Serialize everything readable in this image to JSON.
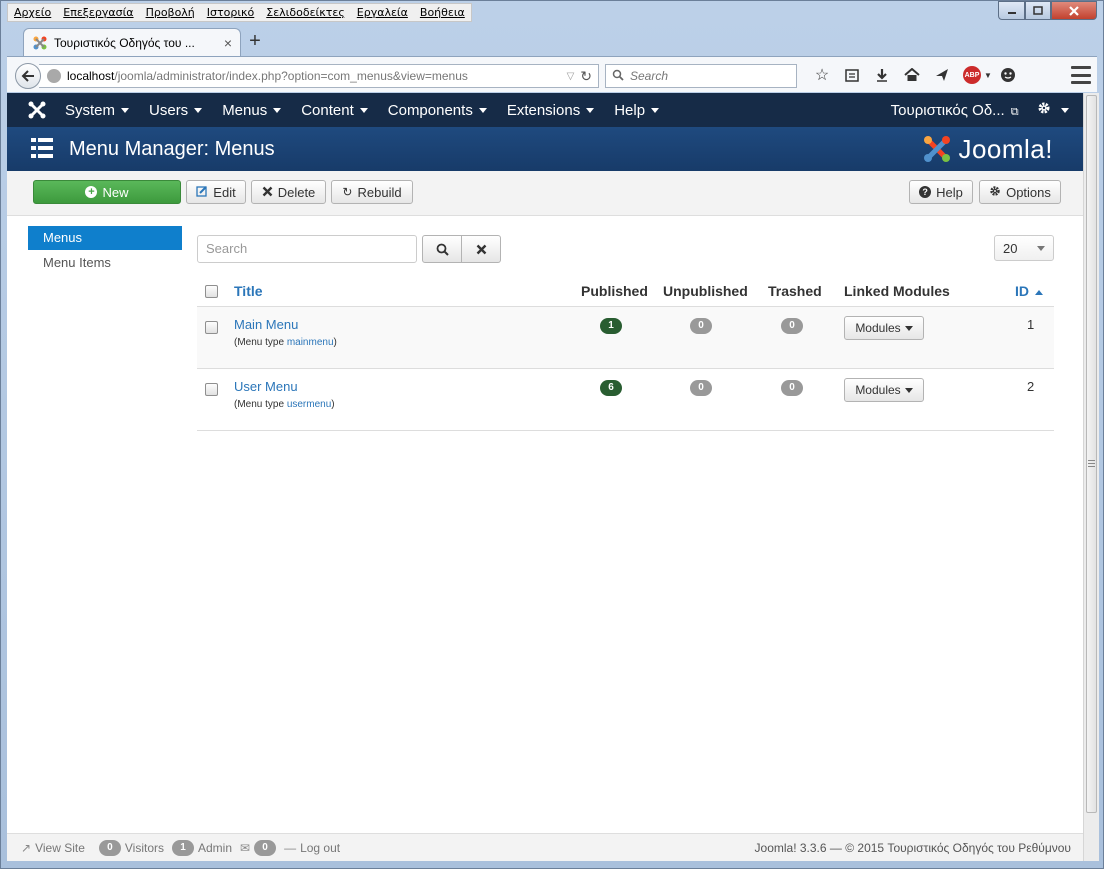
{
  "browser": {
    "menu": [
      "Αρχείο",
      "Επεξεργασία",
      "Προβολή",
      "Ιστορικό",
      "Σελιδοδείκτες",
      "Εργαλεία",
      "Βοήθεια"
    ],
    "tab_title": "Τουριστικός Οδηγός του ...",
    "url_host": "localhost",
    "url_path": "/joomla/administrator/index.php?option=com_menus&view=menus",
    "search_placeholder": "Search",
    "new_tab_symbol": "+",
    "tab_close_symbol": "×",
    "abp_label": "ABP"
  },
  "nav": {
    "items": [
      {
        "label": "System"
      },
      {
        "label": "Users"
      },
      {
        "label": "Menus"
      },
      {
        "label": "Content"
      },
      {
        "label": "Components"
      },
      {
        "label": "Extensions"
      },
      {
        "label": "Help"
      }
    ],
    "site_name": "Τουριστικός Οδ...",
    "settings_icon": "gear-icon"
  },
  "header": {
    "title": "Menu Manager: Menus",
    "brand": "Joomla!"
  },
  "toolbar": {
    "new_label": "New",
    "edit_label": "Edit",
    "delete_label": "Delete",
    "rebuild_label": "Rebuild",
    "help_label": "Help",
    "options_label": "Options"
  },
  "sidebar": {
    "items": [
      {
        "label": "Menus",
        "active": true
      },
      {
        "label": "Menu Items",
        "active": false
      }
    ]
  },
  "filters": {
    "search_placeholder": "Search",
    "list_limit": "20"
  },
  "table": {
    "headers": {
      "title": "Title",
      "published": "Published",
      "unpublished": "Unpublished",
      "trashed": "Trashed",
      "linked_modules": "Linked Modules",
      "id": "ID"
    },
    "menu_type_prefix": "(Menu type ",
    "menu_type_suffix": ")",
    "modules_button": "Modules",
    "rows": [
      {
        "title": "Main Menu",
        "menu_type": "mainmenu",
        "published": "1",
        "unpublished": "0",
        "trashed": "0",
        "id": "1"
      },
      {
        "title": "User Menu",
        "menu_type": "usermenu",
        "published": "6",
        "unpublished": "0",
        "trashed": "0",
        "id": "2"
      }
    ]
  },
  "footer": {
    "view_site": "View Site",
    "visitors_count": "0",
    "visitors_label": "Visitors",
    "admin_count": "1",
    "admin_label": "Admin",
    "messages_count": "0",
    "logout": "Log out",
    "copyright": "Joomla! 3.3.6  —  © 2015 Τουριστικός Οδηγός του Ρεθύμνου"
  },
  "colors": {
    "nav_bg": "#162b47",
    "header_bg": "#1f4a7f",
    "accent": "#2b76b9",
    "new_button": "#46a546",
    "published_badge": "#295d31",
    "sidebar_active": "#0f7fcc"
  }
}
